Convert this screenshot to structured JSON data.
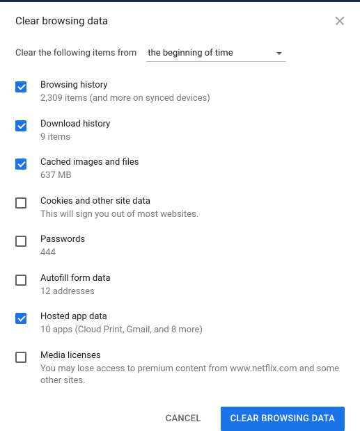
{
  "title": "Clear browsing data",
  "timeframe": {
    "label": "Clear the following items from",
    "selected": "the beginning of time"
  },
  "items": [
    {
      "checked": true,
      "label": "Browsing history",
      "desc": "2,309 items (and more on synced devices)"
    },
    {
      "checked": true,
      "label": "Download history",
      "desc": "9 items"
    },
    {
      "checked": true,
      "label": "Cached images and files",
      "desc": "637 MB"
    },
    {
      "checked": false,
      "label": "Cookies and other site data",
      "desc": "This will sign you out of most websites."
    },
    {
      "checked": false,
      "label": "Passwords",
      "desc": "444"
    },
    {
      "checked": false,
      "label": "Autofill form data",
      "desc": "12 addresses"
    },
    {
      "checked": true,
      "label": "Hosted app data",
      "desc": "10 apps (Cloud Print, Gmail, and 8 more)"
    },
    {
      "checked": false,
      "label": "Media licenses",
      "desc": "You may lose access to premium content from www.netflix.com and some other sites."
    }
  ],
  "actions": {
    "cancel": "CANCEL",
    "confirm": "CLEAR BROWSING DATA"
  }
}
